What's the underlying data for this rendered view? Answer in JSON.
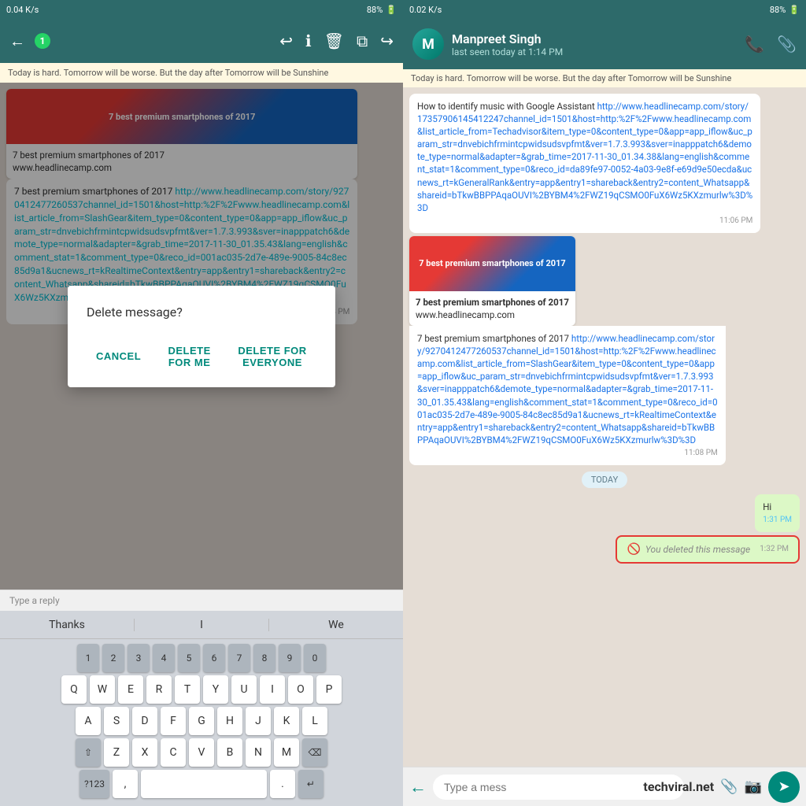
{
  "left": {
    "status_bar": {
      "speed": "0.04 K/s",
      "battery": "88%"
    },
    "header": {
      "back": "←",
      "badge": "1",
      "title": ""
    },
    "marquee": "Today is hard. Tomorrow will be worse. But the day after Tomorrow will be Sunshine",
    "message1": {
      "title": "7 best premium smartphones of 2017",
      "url": "http://www.headlinecamp.com/story/9270412477260537channel_id=1501&host=http:%2F%2Fwww.headlinecamp.com&list_article_from=SlashGear&item_type=0&content_type=0&app=app_iflow&uc_param_str=dnvebichfrmintcpwidsudsvpfmt&ver=1.7.3.993&sver=inapppatch6&demote_type=normal&adapter=&grab_time=2017-11-30_01.35.43&lang=english&comment_stat=1&comment_type=0&reco_id=001ac035-2d7e-489e-9005-84c8ec85d9a1&ucnews_rt=kRealtimeContext&entry=app&entry1=shareback&entry2=content_Whatsapp&shareid=bTkwBBPPAqaOUVI%2BYBM4%2FWZ19qCSMO0FuX6Wz5KXzmurlw%3D%3D",
      "time": "11:08 PM"
    },
    "dialog": {
      "title": "Delete message?",
      "cancel": "CANCEL",
      "delete_for_me": "DELETE FOR ME",
      "delete_for_everyone": "DELETE FOR EVERYONE"
    },
    "reply_bar": {
      "placeholder": "Type a reply"
    },
    "keyboard": {
      "suggestions": [
        "Thanks",
        "I",
        "We"
      ],
      "number_row": [
        "1",
        "2",
        "3",
        "4",
        "5",
        "6",
        "7",
        "8",
        "9",
        "0"
      ],
      "row1": [
        "Q",
        "W",
        "E",
        "R",
        "T",
        "Y",
        "U",
        "I",
        "O",
        "P"
      ],
      "row2": [
        "A",
        "S",
        "D",
        "F",
        "G",
        "H",
        "J",
        "K",
        "L"
      ],
      "row3": [
        "Z",
        "X",
        "C",
        "V",
        "B",
        "N",
        "M"
      ],
      "special_left": "⇧",
      "special_right": "⌫",
      "bottom_left": "?123",
      "space_label": "",
      "bottom_right": ".",
      "enter_key": "↵"
    }
  },
  "right": {
    "status_bar": {
      "speed": "0.02 K/s",
      "battery": "88%"
    },
    "header": {
      "contact_name": "Manpreet Singh",
      "contact_status": "last seen today at 1:14 PM",
      "phone_icon": "📞",
      "attachment_icon": "📎"
    },
    "marquee": "Today is hard. Tomorrow will be worse. But the day after Tomorrow will be Sunshine",
    "messages": [
      {
        "type": "received",
        "text": "How to identify music with Google Assistant",
        "url": "http://www.headlinecamp.com/story/17357906145412247channel_id=1501&host=http:%2F%2Fwww.headlinecamp.com&list_article_from=Techadvisor&item_type=0&content_type=0&app=app_iflow&uc_param_str=dnvebichfrmintcpwidsudsvpfmt&ver=1.7.3.993&sver=inapppatch6&demote_type=normal&adapter=&grab_time=2017-11-30_01.34.38&lang=english&comment_stat=1&comment_type=0&reco_id=da89fe97-0052-4a03-9e8f-e69d9e50ecda&ucnews_rt=kGeneralRank&entry=app&entry1=shareback&entry2=content_Whatsapp&shareid=bTkwBBPPAqaOUVI%2BYBM4%2FWZ19qCSMO0FuX6Wz5KXzmurlw%3D%3D",
        "time": "11:06 PM"
      },
      {
        "type": "link_preview",
        "preview_title": "7 best premium smartphones of 2017",
        "preview_domain": "www.headlinecamp.com",
        "text": "7 best premium smartphones of 2017",
        "url": "http://www.headlinecamp.com/story/9270412477260537channel_id=1501&host=http:%2F%2Fwww.headlinecamp.com&list_article_from=SlashGear&item_type=0&content_type=0&app=app_iflow&uc_param_str=dnvebichfrmintcpwidsudsvpfmt&ver=1.7.3.993&sver=inapppatch6&demote_type=normal&adapter=&grab_time=2017-11-30_01.35.43&lang=english&comment_stat=1&comment_type=0&reco_id=001ac035-2d7e-489e-9005-84c8ec85d9a1&ucnews_rt=kRealtimeContext&entry=app&entry1=shareback&entry2=content_Whatsapp&shareid=bTkwBBPPAqaOUVI%2BYBM4%2FWZ19qCSMO0FuX6Wz5KXzmurlw%3D%3D",
        "time": "11:08 PM"
      },
      {
        "type": "date_divider",
        "label": "TODAY"
      },
      {
        "type": "sent",
        "text": "Hi",
        "time": "1:31 PM"
      },
      {
        "type": "deleted",
        "text": "You deleted this message",
        "time": "1:32 PM"
      }
    ],
    "input_bar": {
      "placeholder": "Type a mess",
      "watermark": "techviral.net"
    }
  }
}
